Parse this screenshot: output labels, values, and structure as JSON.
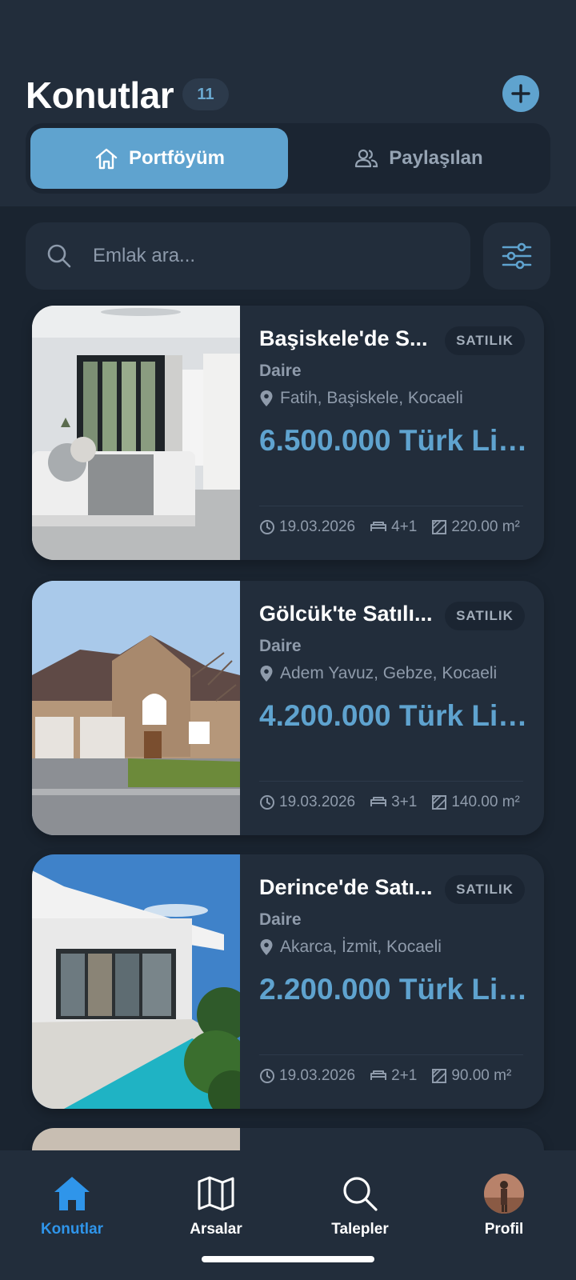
{
  "header": {
    "title": "Konutlar",
    "count": "11",
    "tabs": [
      {
        "label": "Portföyüm",
        "icon": "home-icon",
        "active": true
      },
      {
        "label": "Paylaşılan",
        "icon": "users-icon",
        "active": false
      }
    ]
  },
  "search": {
    "placeholder": "Emlak ara...",
    "value": ""
  },
  "colors": {
    "accent": "#5fa3cf",
    "nav_active": "#2f95ea",
    "background": "#1a2430",
    "card": "#222d3b"
  },
  "listings": [
    {
      "title": "Başiskele'de S...",
      "badge": "SATILIK",
      "type": "Daire",
      "location": "Fatih, Başiskele, Kocaeli",
      "price": "6.500.000 Türk Lir...",
      "date": "19.03.2026",
      "rooms": "4+1",
      "area": "220.00 m²"
    },
    {
      "title": "Gölcük'te Satılı...",
      "badge": "SATILIK",
      "type": "Daire",
      "location": "Adem Yavuz, Gebze, Kocaeli",
      "price": "4.200.000 Türk Lir...",
      "date": "19.03.2026",
      "rooms": "3+1",
      "area": "140.00 m²"
    },
    {
      "title": "Derince'de Satı...",
      "badge": "SATILIK",
      "type": "Daire",
      "location": "Akarca, İzmit, Kocaeli",
      "price": "2.200.000 Türk Lir...",
      "date": "19.03.2026",
      "rooms": "2+1",
      "area": "90.00 m²"
    }
  ],
  "bottom_nav": [
    {
      "label": "Konutlar",
      "icon": "home-icon",
      "active": true
    },
    {
      "label": "Arsalar",
      "icon": "map-icon",
      "active": false
    },
    {
      "label": "Talepler",
      "icon": "search-icon",
      "active": false
    },
    {
      "label": "Profil",
      "icon": "avatar",
      "active": false
    }
  ]
}
